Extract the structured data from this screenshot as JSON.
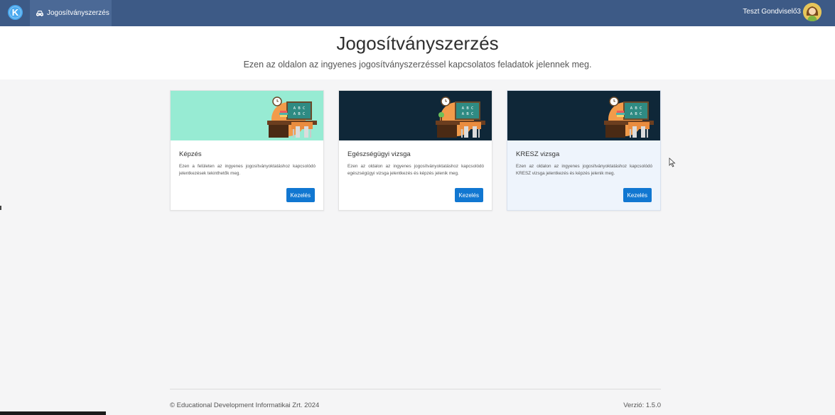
{
  "topbar": {
    "logo_letter": "K",
    "nav_label": "Jogosítványszerzés",
    "user_name": "Teszt Gondviselő3",
    "bg_color": "#3d5a86"
  },
  "header": {
    "title": "Jogosítványszerzés",
    "subtitle": "Ezen az oldalon az ingyenes jogosítványszerzéssel kapcsolatos feladatok jelennek meg."
  },
  "cards": [
    {
      "title": "Képzés",
      "text": "Ezen a felületen az ingyenes jogosítványoktatáshoz kapcsolódó jelentkezések tekinthetők meg.",
      "button": "Kezelés",
      "image_bg": "#97ebd3",
      "board_text_1": "A B C",
      "board_text_2": "A B C"
    },
    {
      "title": "Egészségügyi vizsga",
      "text": "Ezen az oldalon az ingyenes jogosítványoktatáshoz kapcsolódó egészségügyi vizsga jelentkezés és képzés jelenik meg.",
      "button": "Kezelés",
      "image_bg": "#0f2738",
      "board_text_1": "A B C",
      "board_text_2": "A B C"
    },
    {
      "title": "KRESZ vizsga",
      "text": "Ezen az oldalon az ingyenes jogosítványoktatáshoz kapcsolódó KRESZ vizsga jelentkezés és képzés jelenik meg.",
      "button": "Kezelés",
      "image_bg": "#0f2738",
      "board_text_1": "A B C",
      "board_text_2": "A B C"
    }
  ],
  "footer": {
    "copyright": "© Educational Development Informatikai Zrt. 2024",
    "version": "Verzió: 1.5.0"
  },
  "colors": {
    "button": "#1177d1",
    "page_bg": "#f5f5f6"
  }
}
